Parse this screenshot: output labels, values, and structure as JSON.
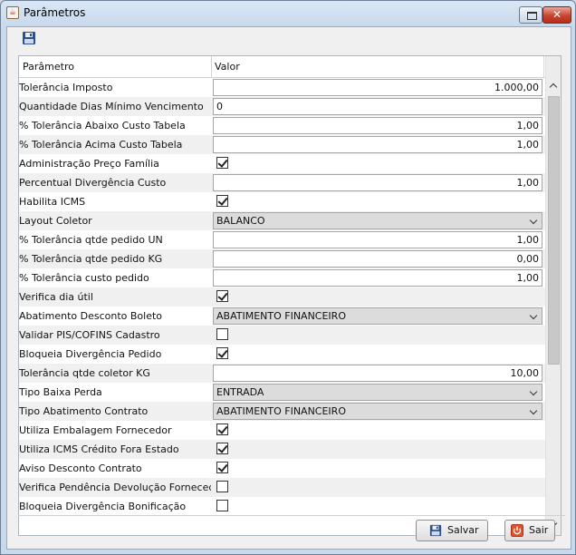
{
  "window": {
    "title": "Parâmetros"
  },
  "table": {
    "col_param": "Parâmetro",
    "col_valor": "Valor",
    "rows": [
      {
        "label": "Tolerância Imposto",
        "type": "text",
        "value": "1.000,00",
        "align": "right"
      },
      {
        "label": "Quantidade Dias Mínimo Vencimento",
        "type": "text",
        "value": "0",
        "align": "left"
      },
      {
        "label": "% Tolerância Abaixo Custo Tabela",
        "type": "text",
        "value": "1,00",
        "align": "right"
      },
      {
        "label": "% Tolerância Acima Custo Tabela",
        "type": "text",
        "value": "1,00",
        "align": "right"
      },
      {
        "label": "Administração Preço Família",
        "type": "check",
        "checked": true
      },
      {
        "label": "Percentual Divergência Custo",
        "type": "text",
        "value": "1,00",
        "align": "right"
      },
      {
        "label": "Habilita ICMS",
        "type": "check",
        "checked": true
      },
      {
        "label": "Layout Coletor",
        "type": "combo",
        "value": "BALANCO"
      },
      {
        "label": "% Tolerância qtde pedido UN",
        "type": "text",
        "value": "1,00",
        "align": "right"
      },
      {
        "label": "% Tolerância qtde pedido KG",
        "type": "text",
        "value": "0,00",
        "align": "right"
      },
      {
        "label": "% Tolerância custo pedido",
        "type": "text",
        "value": "1,00",
        "align": "right"
      },
      {
        "label": "Verifica dia útil",
        "type": "check",
        "checked": true
      },
      {
        "label": "Abatimento Desconto Boleto",
        "type": "combo",
        "value": "ABATIMENTO FINANCEIRO"
      },
      {
        "label": "Validar PIS/COFINS Cadastro",
        "type": "check",
        "checked": false
      },
      {
        "label": "Bloqueia Divergência Pedido",
        "type": "check",
        "checked": true
      },
      {
        "label": "Tolerância qtde coletor KG",
        "type": "text",
        "value": "10,00",
        "align": "right"
      },
      {
        "label": "Tipo Baixa Perda",
        "type": "combo",
        "value": "ENTRADA"
      },
      {
        "label": "Tipo Abatimento Contrato",
        "type": "combo",
        "value": "ABATIMENTO FINANCEIRO"
      },
      {
        "label": "Utiliza Embalagem Fornecedor",
        "type": "check",
        "checked": true
      },
      {
        "label": "Utiliza ICMS Crédito Fora Estado",
        "type": "check",
        "checked": true
      },
      {
        "label": "Aviso Desconto Contrato",
        "type": "check",
        "checked": true
      },
      {
        "label": "Verifica Pendência Devolução Fornecedor",
        "type": "check",
        "checked": false
      },
      {
        "label": "Bloqueia Divergência Bonificação",
        "type": "check",
        "checked": false
      }
    ]
  },
  "buttons": {
    "save": "Salvar",
    "exit": "Sair"
  },
  "icons": {
    "app": "java-cup-icon",
    "save": "floppy-disk-icon",
    "exit": "power-icon"
  }
}
